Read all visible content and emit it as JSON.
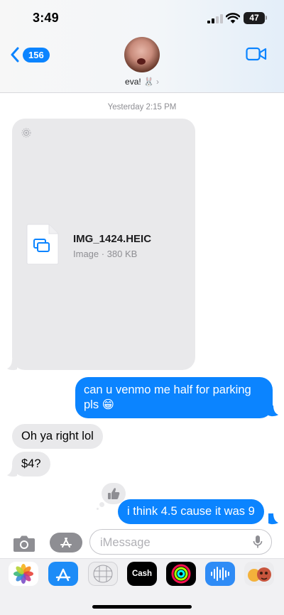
{
  "status_bar": {
    "time": "3:49",
    "battery_level": "47",
    "signal_bars": 2
  },
  "header": {
    "back_count": "156",
    "contact_name": "eva! 🐰",
    "contact_chevron": "›",
    "icons": [
      "chevron-left-icon",
      "video-camera-icon"
    ]
  },
  "conversation": {
    "timestamp": "Yesterday 2:15 PM",
    "attachment": {
      "file_name": "IMG_1424.HEIC",
      "file_meta": "Image · 380 KB",
      "icon": "image-file-icon"
    },
    "messages": [
      {
        "direction": "sent",
        "text": "can u venmo me half for parking pls 😁"
      },
      {
        "direction": "received",
        "text": "Oh ya right lol"
      },
      {
        "direction": "received",
        "text": "$4?"
      },
      {
        "direction": "sent",
        "text": "i think 4.5 cause it was 9",
        "reaction": "thumbs-up-icon"
      }
    ]
  },
  "input_bar": {
    "placeholder": "iMessage",
    "icons": [
      "camera-icon",
      "app-store-icon",
      "microphone-icon"
    ]
  },
  "app_drawer": {
    "apps": [
      {
        "name": "Photos",
        "icon": "photos-icon"
      },
      {
        "name": "App Store",
        "icon": "app-store-icon"
      },
      {
        "name": "Digital Touch",
        "icon": "digital-touch-icon"
      },
      {
        "name": "Cash",
        "label": "Cash",
        "icon": "apple-cash-icon"
      },
      {
        "name": "Fitness",
        "icon": "activity-rings-icon"
      },
      {
        "name": "Audio Message",
        "icon": "waveform-icon"
      },
      {
        "name": "Memoji",
        "icon": "memoji-icon"
      }
    ]
  },
  "colors": {
    "accent": "#0b84ff",
    "received_bubble": "#e9e9eb",
    "timestamp": "#8e8e93"
  }
}
